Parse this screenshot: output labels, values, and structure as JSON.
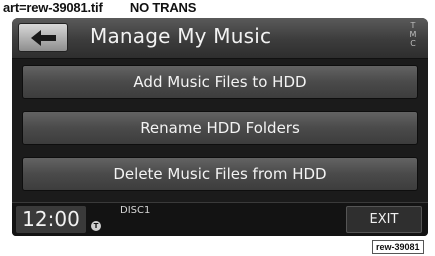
{
  "caption": {
    "art": "art=rew-39081.tif",
    "trans": "NO TRANS"
  },
  "header": {
    "back_icon": "left-arrow-icon",
    "title": "Manage My Music",
    "tmc": [
      "T",
      "M",
      "C"
    ]
  },
  "menu": {
    "items": [
      {
        "label": "Add Music Files to HDD"
      },
      {
        "label": "Rename HDD Folders"
      },
      {
        "label": "Delete Music Files from HDD"
      }
    ]
  },
  "status": {
    "time": "12:00",
    "t_badge": "T",
    "disc": "DISC1",
    "exit_label": "EXIT"
  },
  "reference": "rew-39081",
  "colors": {
    "screen_bg": "#1b1b1b",
    "button_face": "#4a4a4a",
    "text": "#f3f3f3"
  }
}
